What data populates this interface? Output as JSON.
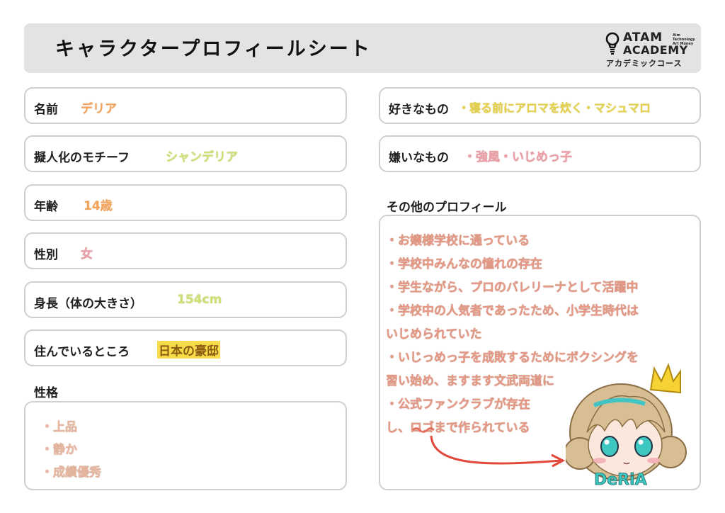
{
  "header": {
    "title": "キャラクタープロフィールシート",
    "logo": {
      "line1": "ATAM",
      "line1_sub": [
        "Aim Technology",
        "Art Money"
      ],
      "line2": "ACADEMY",
      "line3": "アカデミックコース"
    }
  },
  "fields": {
    "name": {
      "label": "名前",
      "value": "デリア"
    },
    "motif": {
      "label": "擬人化のモチーフ",
      "value": "シャンデリア"
    },
    "age": {
      "label": "年齢",
      "value": "14歳"
    },
    "gender": {
      "label": "性別",
      "value": "女"
    },
    "height": {
      "label": "身長（体の大きさ）",
      "value": "154cm"
    },
    "residence": {
      "label": "住んでいるところ",
      "value": "日本の豪邸"
    },
    "likes": {
      "label": "好きなもの",
      "value": "・寝る前にアロマを炊く・マシュマロ"
    },
    "dislikes": {
      "label": "嫌いなもの",
      "value": "・強風・いじめっ子"
    }
  },
  "personality": {
    "title": "性格",
    "items": [
      "・上品",
      "・静か",
      "・成績優秀"
    ]
  },
  "other_profile": {
    "title": "その他のプロフィール",
    "lines": [
      "・お嬢様学校に通っている",
      "・学校中みんなの憧れの存在",
      "・学生ながら、プロのバレリーナとして活躍中",
      "・学校中の人気者であったため、小学生時代は",
      "いじめられていた",
      "・いじっめっ子を成敗するためにボクシングを",
      "習い始め、ますます文武両道に",
      "・公式ファンクラブが存在",
      "し、ロゴまで作られている"
    ],
    "signature": "DeRiA"
  }
}
